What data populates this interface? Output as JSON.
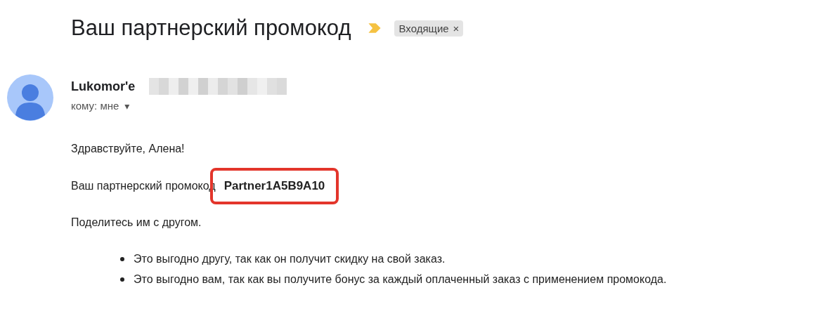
{
  "subject": "Ваш партнерский промокод",
  "label_marker": {
    "important": true
  },
  "labels": [
    {
      "text": "Входящие",
      "remove": "×"
    }
  ],
  "sender": {
    "name": "Lukomor'e",
    "address_blurred": true,
    "recipient": "кому: мне",
    "recipient_menu": "▾"
  },
  "body": {
    "greeting": "Здравствуйте, Алена!",
    "promo_line": {
      "text": "Ваш партнерский промокод",
      "code": "Partner1A5B9A10",
      "highlighted": true
    },
    "share_line": "Поделитесь им с другом.",
    "bullets": [
      "Это выгодно другу, так как он получит скидку на свой заказ.",
      "Это выгодно вам, так как вы получите бонус за каждый оплаченный заказ с применением промокода."
    ]
  }
}
